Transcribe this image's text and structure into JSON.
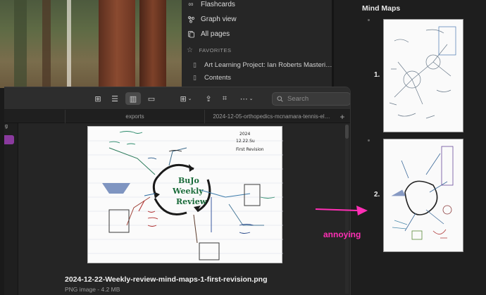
{
  "sidebar": {
    "nav": [
      {
        "label": "Flashcards",
        "icon": "infinity-icon"
      },
      {
        "label": "Graph view",
        "icon": "graph-icon"
      },
      {
        "label": "All pages",
        "icon": "pages-icon"
      }
    ],
    "favorites_header": "FAVORITES",
    "favorites": [
      {
        "label": "Art Learning Project: Ian Roberts Masteri…",
        "icon": "page-icon"
      },
      {
        "label": "Contents",
        "icon": "page-icon"
      }
    ]
  },
  "right_pane": {
    "heading": "Mind Maps",
    "items": [
      {
        "number": "1."
      },
      {
        "number": "2."
      }
    ]
  },
  "finder": {
    "search_placeholder": "Search",
    "tabs": [
      {
        "label": "exports"
      },
      {
        "label": "2024-12-05-orthopedics-mcnamara-tennis-el…"
      }
    ],
    "add_tab": "+",
    "file_name": "2024-12-22-Weekly-review-mind-maps-1-first-revision.png",
    "file_meta": "PNG image - 4.2 MB"
  },
  "sketch": {
    "center_lines": [
      "BuJo",
      "Weekly",
      "Review"
    ],
    "date_lines": [
      "2024",
      "12.22.Su",
      "First Revision"
    ]
  },
  "annotation": {
    "text": "annoying",
    "color": "#ff2fb5"
  },
  "colors": {
    "selection": "#8a3a9e",
    "accent_text": "#e8e8e8"
  }
}
